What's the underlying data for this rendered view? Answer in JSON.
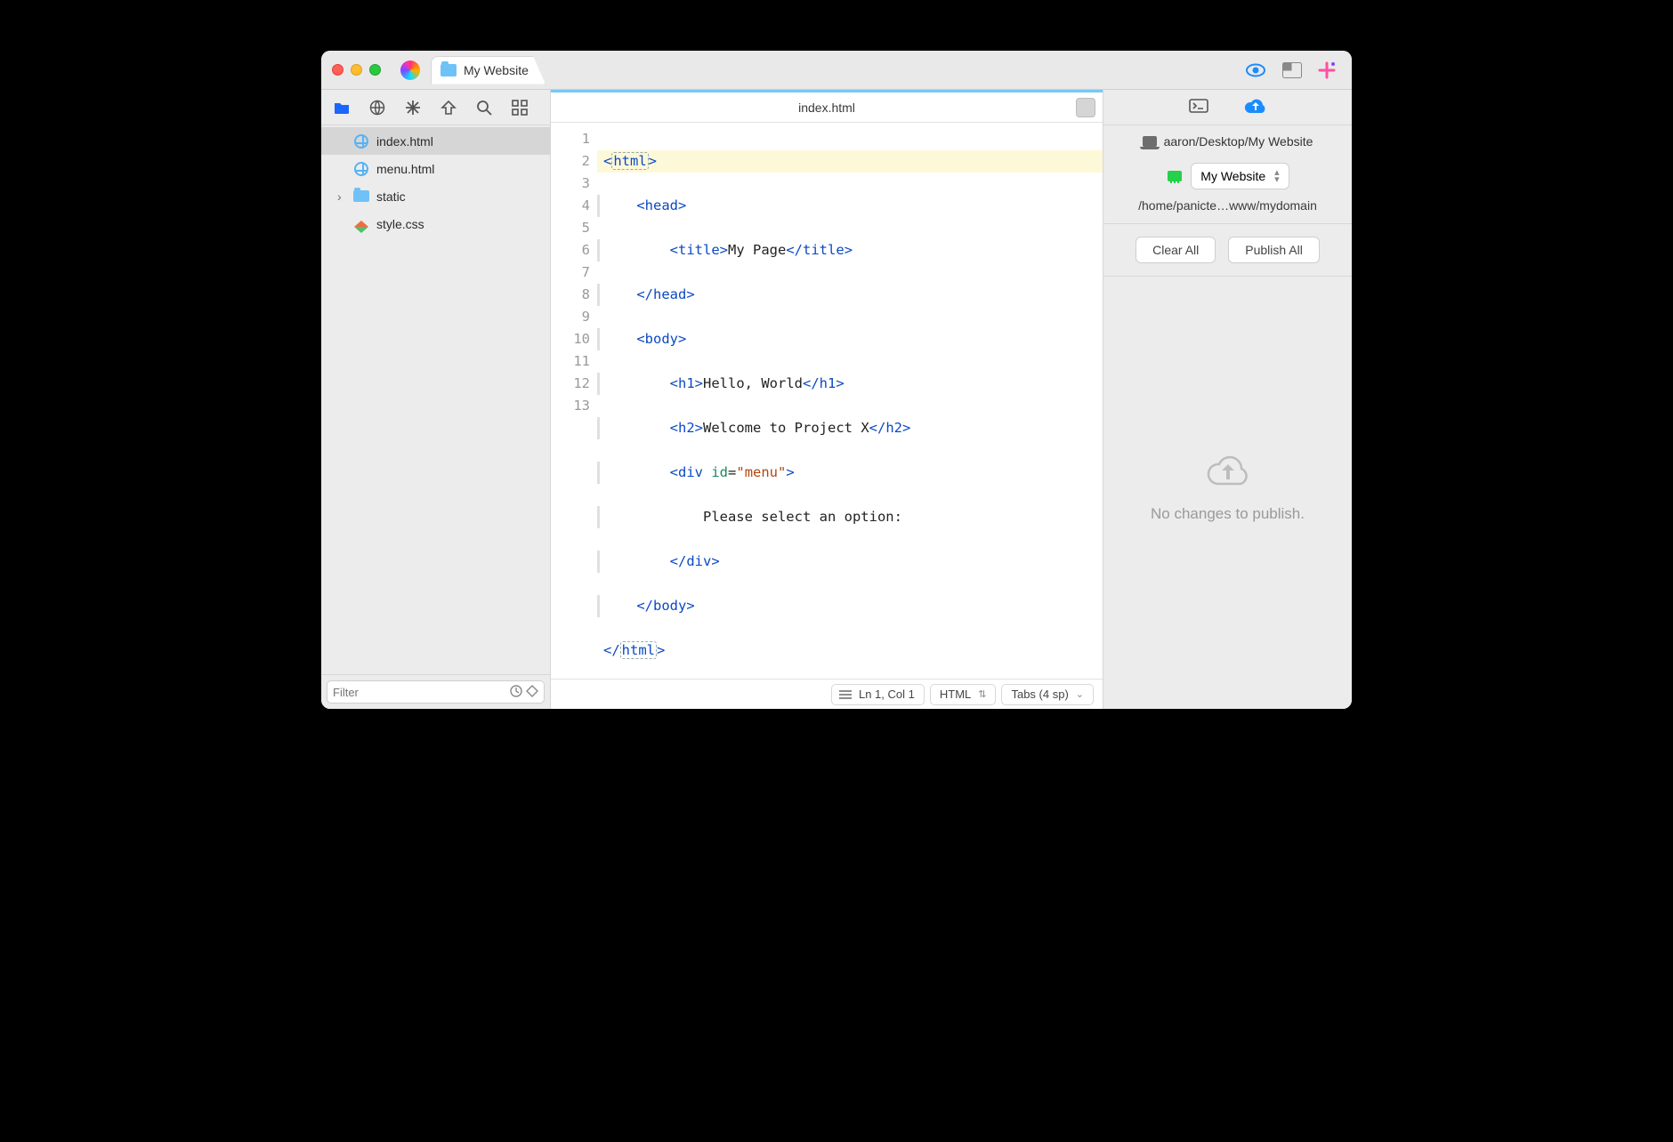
{
  "titlebar": {
    "tab_title": "My Website"
  },
  "sidebar": {
    "filter_placeholder": "Filter",
    "files": [
      {
        "name": "index.html",
        "kind": "html",
        "selected": true
      },
      {
        "name": "menu.html",
        "kind": "html",
        "selected": false
      },
      {
        "name": "static",
        "kind": "folder",
        "selected": false,
        "expandable": true
      },
      {
        "name": "style.css",
        "kind": "css",
        "selected": false
      }
    ]
  },
  "editor": {
    "filename": "index.html",
    "cursor": "Ln 1, Col 1",
    "language": "HTML",
    "indent": "Tabs (4 sp)",
    "line_count": 13,
    "code": {
      "l1": {
        "pre": "<",
        "tag": "html",
        "post": ">"
      },
      "l2": {
        "pre": "    <",
        "tag": "head",
        "post": ">"
      },
      "l3": {
        "open": "        <",
        "tago": "title",
        "mid": ">",
        "text": "My Page",
        "close_open": "</",
        "tagc": "title",
        "close": ">"
      },
      "l4": {
        "pre": "    </",
        "tag": "head",
        "post": ">"
      },
      "l5": {
        "pre": "    <",
        "tag": "body",
        "post": ">"
      },
      "l6": {
        "open": "        <",
        "tago": "h1",
        "mid": ">",
        "text": "Hello, World",
        "close_open": "</",
        "tagc": "h1",
        "close": ">"
      },
      "l7": {
        "open": "        <",
        "tago": "h2",
        "mid": ">",
        "text": "Welcome to Project X",
        "close_open": "</",
        "tagc": "h2",
        "close": ">"
      },
      "l8": {
        "open": "        <",
        "tago": "div",
        "sp": " ",
        "attr": "id",
        "eq": "=",
        "val": "\"menu\"",
        "close": ">"
      },
      "l9": {
        "text": "            Please select an option:"
      },
      "l10": {
        "pre": "        </",
        "tag": "div",
        "post": ">"
      },
      "l11": {
        "pre": "    </",
        "tag": "body",
        "post": ">"
      },
      "l12": {
        "pre": "</",
        "tag": "html",
        "post": ">"
      }
    }
  },
  "inspector": {
    "local_path": "aaron/Desktop/My Website",
    "site_name": "My Website",
    "remote_path": "/home/panicte…www/mydomain",
    "clear_label": "Clear All",
    "publish_label": "Publish All",
    "empty_message": "No changes to publish."
  }
}
